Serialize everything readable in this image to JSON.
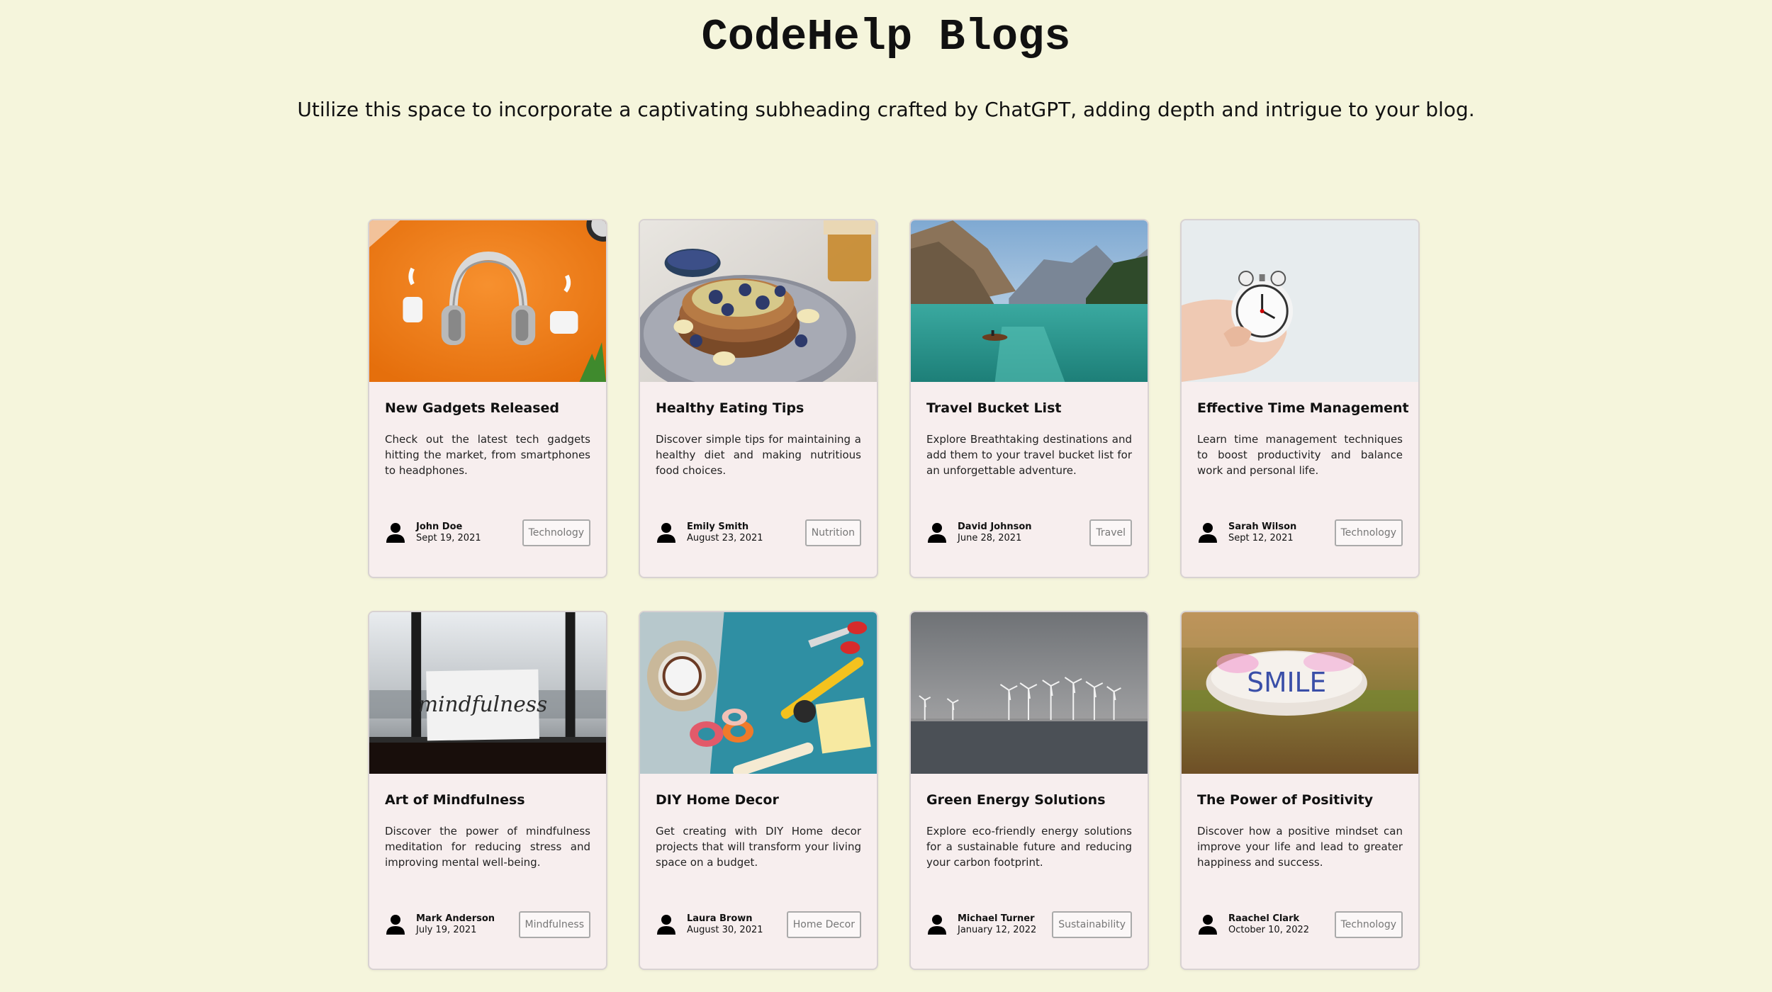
{
  "header": {
    "title": "CodeHelp Blogs",
    "subtitle": "Utilize this space to incorporate a captivating subheading crafted by ChatGPT, adding depth and intrigue to your blog."
  },
  "colors": {
    "page_background": "#f5f5dc",
    "card_background": "#f7eeee",
    "card_border": "#d8d2d2",
    "tag_text": "#777777"
  },
  "posts": [
    {
      "title": "New Gadgets Released",
      "description": "Check out the latest tech gadgets hitting the market, from smartphones to headphones.",
      "author": "John Doe",
      "date": "Sept 19, 2021",
      "tag": "Technology",
      "image_icon": "headphones-photo",
      "author_icon": "user-icon"
    },
    {
      "title": "Healthy Eating Tips",
      "description": "Discover simple tips for maintaining a healthy diet and making nutritious food choices.",
      "author": "Emily Smith",
      "date": "August 23, 2021",
      "tag": "Nutrition",
      "image_icon": "pancakes-photo",
      "author_icon": "user-icon"
    },
    {
      "title": "Travel Bucket List",
      "description": "Explore Breathtaking destinations and add them to your travel bucket list for an unforgettable adventure.",
      "author": "David Johnson",
      "date": "June 28, 2021",
      "tag": "Travel",
      "image_icon": "mountain-lake-photo",
      "author_icon": "user-icon"
    },
    {
      "title": "Effective Time Management",
      "description": "Learn time management techniques to boost productivity and balance work and personal life.",
      "author": "Sarah Wilson",
      "date": "Sept 12, 2021",
      "tag": "Technology",
      "image_icon": "alarm-clock-photo",
      "author_icon": "user-icon"
    },
    {
      "title": "Art of Mindfulness",
      "description": "Discover the power of mindfulness meditation for reducing stress and improving mental well-being.",
      "author": "Mark Anderson",
      "date": "July 19, 2021",
      "tag": "Mindfulness",
      "image_icon": "mindfulness-card-photo",
      "image_text": "mindfulness",
      "author_icon": "user-icon"
    },
    {
      "title": "DIY Home Decor",
      "description": "Get creating with DIY Home decor projects that will transform your living space on a budget.",
      "author": "Laura Brown",
      "date": "August 30, 2021",
      "tag": "Home Decor",
      "image_icon": "craft-tools-photo",
      "author_icon": "user-icon"
    },
    {
      "title": "Green Energy Solutions",
      "description": "Explore eco-friendly energy solutions for a sustainable future and reducing your carbon footprint.",
      "author": "Michael Turner",
      "date": "January 12, 2022",
      "tag": "Sustainability",
      "image_icon": "wind-turbines-photo",
      "author_icon": "user-icon"
    },
    {
      "title": "The Power of Positivity",
      "description": "Discover how a positive mindset can improve your life and lead to greater happiness and success.",
      "author": "Raachel Clark",
      "date": "October 10, 2022",
      "tag": "Technology",
      "image_icon": "smile-stone-photo",
      "image_text": "SMILE",
      "author_icon": "user-icon"
    }
  ]
}
